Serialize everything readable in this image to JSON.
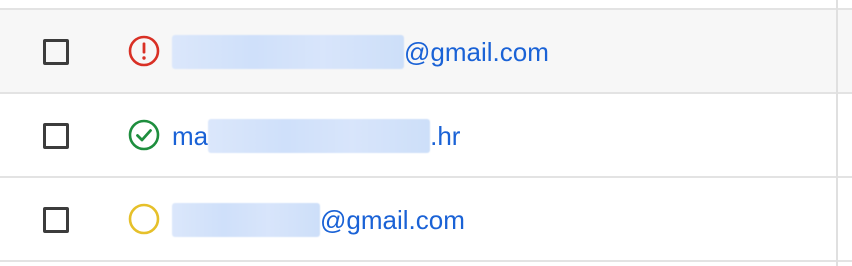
{
  "rows": [
    {
      "status": "error",
      "status_icon": "error-circle-icon",
      "status_color": "#d93025",
      "email_prefix": "",
      "email_suffix": "@gmail.com"
    },
    {
      "status": "verified",
      "status_icon": "check-circle-icon",
      "status_color": "#1e8e3e",
      "email_prefix": "ma",
      "email_suffix": ".hr"
    },
    {
      "status": "pending",
      "status_icon": "empty-circle-icon",
      "status_color": "#e6c02a",
      "email_prefix": "",
      "email_suffix": "@gmail.com"
    }
  ],
  "colors": {
    "link": "#1a62d6",
    "checkbox_border": "#3c3c3c",
    "row_hover_bg": "#f7f7f7",
    "divider": "#e3e3e3"
  }
}
